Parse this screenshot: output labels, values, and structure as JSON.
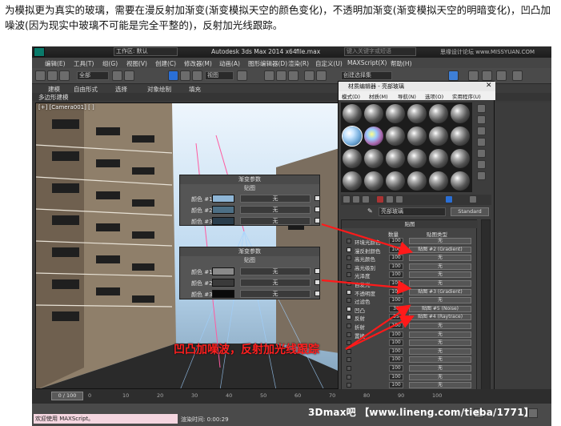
{
  "intro_text": "为模拟更为真实的玻璃，需要在漫反射加渐变(渐变模拟天空的颜色变化)，不透明加渐变(渐变模拟天空的明暗变化)，凹凸加噪波(因为现实中玻璃不可能是完全平整的)，反射加光线跟踪。",
  "window": {
    "app_title": "Autodesk 3ds Max  2014 x64",
    "file_name": "file.max",
    "workspace": "工作区: 默认",
    "search_placeholder": "键入关键字或短语",
    "watermark_top": "思缘设计论坛 www.MISSYUAN.COM"
  },
  "menu": [
    "编辑(E)",
    "工具(T)",
    "组(G)",
    "视图(V)",
    "创建(C)",
    "修改器(M)",
    "动画(A)",
    "图形编辑器(D)",
    "渲染(R)",
    "自定义(U)",
    "MAXScript(X)",
    "帮助(H)"
  ],
  "toolbar": {
    "select_filter": "全部",
    "view_combo": "视图",
    "named_sel": "创建选择集"
  },
  "ribbon": {
    "tabs": [
      "建模",
      "自由形式",
      "选择",
      "对象绘制",
      "填充"
    ],
    "sub": "多边形建模"
  },
  "viewport": {
    "label": "[+] [Camera001] [ ]"
  },
  "gradient_panel_1": {
    "title": "渐变参数",
    "header": "贴图",
    "rows": [
      {
        "label": "颜色 #1",
        "color": "#8fb6d6",
        "btn": "无"
      },
      {
        "label": "颜色 #2",
        "color": "#4d6f85",
        "btn": "无"
      },
      {
        "label": "颜色 #3",
        "color": "#2a3d4c",
        "btn": "无"
      }
    ]
  },
  "gradient_panel_2": {
    "title": "渐变参数",
    "header": "贴图",
    "rows": [
      {
        "label": "颜色 #1",
        "color": "#8a8a8a",
        "btn": "无"
      },
      {
        "label": "颜色 #2",
        "color": "#3a3a3a",
        "btn": "无"
      },
      {
        "label": "颜色 #3",
        "color": "#0a0a0a",
        "btn": "无"
      }
    ]
  },
  "material_editor": {
    "title": "材质编辑器 - 亮部玻璃",
    "menus": [
      "模式(D)",
      "材质(M)",
      "导航(N)",
      "选项(O)",
      "实用程序(U)"
    ],
    "material_name": "亮部玻璃",
    "shader": "Standard",
    "maps_title": "贴图",
    "col_amount": "数量",
    "col_maptype": "贴图类型",
    "maps": [
      {
        "name": "环境光颜色",
        "amount": "100",
        "map": "无",
        "checked": false
      },
      {
        "name": "漫反射颜色",
        "amount": "100",
        "map": "贴图 #2 (Gradient)",
        "checked": true
      },
      {
        "name": "高光颜色",
        "amount": "100",
        "map": "无",
        "checked": false
      },
      {
        "name": "高光级别",
        "amount": "100",
        "map": "无",
        "checked": false
      },
      {
        "name": "光泽度",
        "amount": "100",
        "map": "无",
        "checked": false
      },
      {
        "name": "自发光",
        "amount": "100",
        "map": "无",
        "checked": false
      },
      {
        "name": "不透明度",
        "amount": "100",
        "map": "贴图 #3 (Gradient)",
        "checked": true
      },
      {
        "name": "过滤色",
        "amount": "100",
        "map": "无",
        "checked": false
      },
      {
        "name": "凹凸",
        "amount": "30",
        "map": "贴图 #5 (Noise)",
        "checked": true
      },
      {
        "name": "反射",
        "amount": "35",
        "map": "贴图 #4 (Raytrace)",
        "checked": true
      },
      {
        "name": "折射",
        "amount": "100",
        "map": "无",
        "checked": false
      },
      {
        "name": "置换",
        "amount": "100",
        "map": "无",
        "checked": false
      },
      {
        "name": "",
        "amount": "100",
        "map": "无",
        "checked": false
      },
      {
        "name": "",
        "amount": "100",
        "map": "无",
        "checked": false
      },
      {
        "name": "",
        "amount": "100",
        "map": "无",
        "checked": false
      },
      {
        "name": "",
        "amount": "100",
        "map": "无",
        "checked": false
      },
      {
        "name": "",
        "amount": "100",
        "map": "无",
        "checked": false
      },
      {
        "name": "",
        "amount": "100",
        "map": "无",
        "checked": false
      }
    ]
  },
  "timeline": {
    "range": "0 / 100",
    "ticks": [
      "0",
      "10",
      "20",
      "30",
      "40",
      "50",
      "60",
      "70",
      "80",
      "90",
      "100"
    ]
  },
  "status": {
    "welcome": "欢迎使用 MAXScript。",
    "render_time": "渲染时间: 0:00:29"
  },
  "annotation": "凹凸加噪波，反射加光线跟踪",
  "watermark": "3Dmax吧 【www.lineng.com/tieba/1771】",
  "colors": {
    "arrow": "#ff1a1a"
  }
}
